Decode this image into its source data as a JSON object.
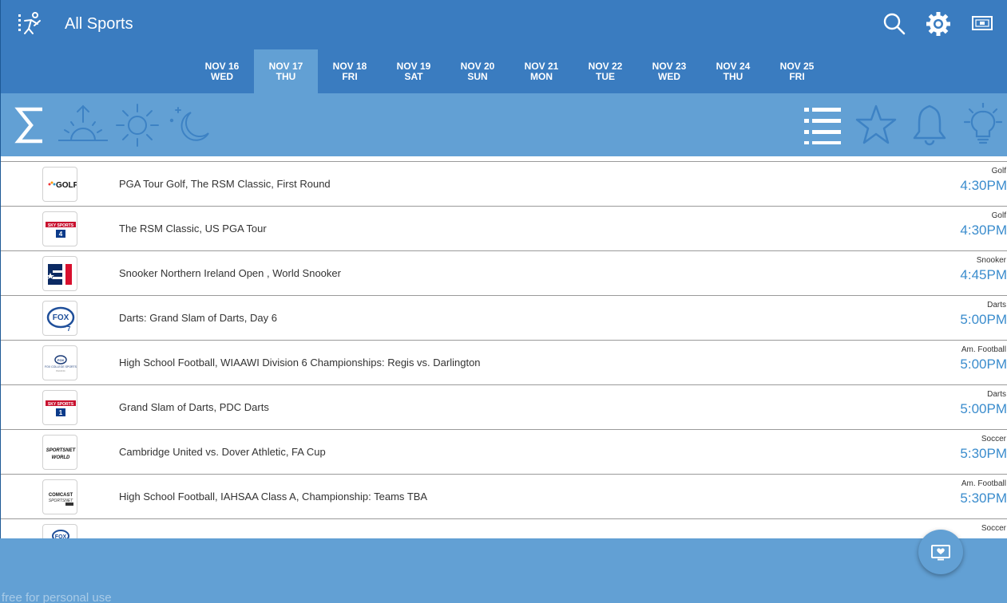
{
  "header": {
    "title": "All Sports"
  },
  "dates": [
    {
      "month_day": "NOV 16",
      "weekday": "WED",
      "active": false
    },
    {
      "month_day": "NOV 17",
      "weekday": "THU",
      "active": true
    },
    {
      "month_day": "NOV 18",
      "weekday": "FRI",
      "active": false
    },
    {
      "month_day": "NOV 19",
      "weekday": "SAT",
      "active": false
    },
    {
      "month_day": "NOV 20",
      "weekday": "SUN",
      "active": false
    },
    {
      "month_day": "NOV 21",
      "weekday": "MON",
      "active": false
    },
    {
      "month_day": "NOV 22",
      "weekday": "TUE",
      "active": false
    },
    {
      "month_day": "NOV 23",
      "weekday": "WED",
      "active": false
    },
    {
      "month_day": "NOV 24",
      "weekday": "THU",
      "active": false
    },
    {
      "month_day": "NOV 25",
      "weekday": "FRI",
      "active": false
    }
  ],
  "events": [
    {
      "channel_logo": "GOLF",
      "title": "PGA Tour Golf, The RSM Classic, First Round",
      "sport": "Golf",
      "time": "4:30PM"
    },
    {
      "channel_logo": "SKY SPORTS 4",
      "title": "The RSM Classic, US PGA Tour",
      "sport": "Golf",
      "time": "4:30PM"
    },
    {
      "channel_logo": "E1",
      "title": "Snooker Northern Ireland Open , World Snooker",
      "sport": "Snooker",
      "time": "4:45PM"
    },
    {
      "channel_logo": "FOX",
      "title": "Darts: Grand Slam of Darts, Day 6",
      "sport": "Darts",
      "time": "5:00PM"
    },
    {
      "channel_logo": "FOX COLLEGE SPORTS",
      "title": "High School Football, WIAAWI Division 6 Championships: Regis vs. Darlington",
      "sport": "Am. Football",
      "time": "5:00PM"
    },
    {
      "channel_logo": "SKY SPORTS 1",
      "title": "Grand Slam of Darts, PDC Darts",
      "sport": "Darts",
      "time": "5:00PM"
    },
    {
      "channel_logo": "SPORTSNET WORLD",
      "title": "Cambridge United vs. Dover Athletic, FA Cup",
      "sport": "Soccer",
      "time": "5:30PM"
    },
    {
      "channel_logo": "COMCAST",
      "title": "High School Football, IAHSAA Class A, Championship: Teams TBA",
      "sport": "Am. Football",
      "time": "5:30PM"
    },
    {
      "channel_logo": "FOX",
      "title": "",
      "sport": "Soccer",
      "time": ""
    }
  ],
  "footer": {
    "watermark": "free for personal use"
  },
  "colors": {
    "header": "#3a7cc0",
    "filterbar": "#62a0d4",
    "time": "#3a8ccd"
  },
  "icons": [
    "app-logo-icon",
    "search-icon",
    "settings-icon",
    "cast-icon",
    "sum-icon",
    "sunrise-icon",
    "sun-icon",
    "moon-icon",
    "list-icon",
    "star-icon",
    "bell-icon",
    "bulb-icon",
    "tv-icon"
  ]
}
